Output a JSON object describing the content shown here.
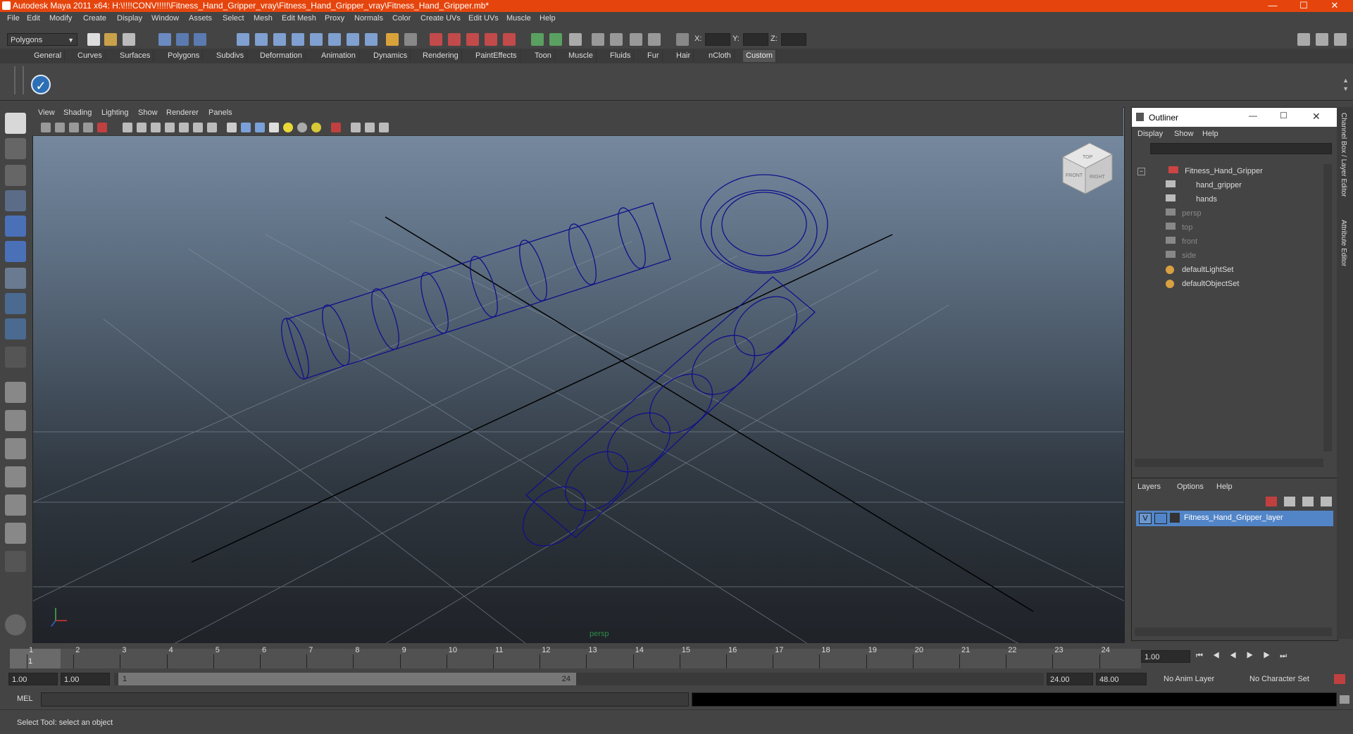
{
  "window": {
    "title": "Autodesk Maya 2011 x64: H:\\!!!!CONV!!!!!\\Fitness_Hand_Gripper_vray\\Fitness_Hand_Gripper_vray\\Fitness_Hand_Gripper.mb*"
  },
  "menu": [
    "File",
    "Edit",
    "Modify",
    "Create",
    "Display",
    "Window",
    "Assets",
    "Select",
    "Mesh",
    "Edit Mesh",
    "Proxy",
    "Normals",
    "Color",
    "Create UVs",
    "Edit UVs",
    "Muscle",
    "Help"
  ],
  "toolbar": {
    "mode": "Polygons",
    "x_label": "X:",
    "y_label": "Y:",
    "z_label": "Z:"
  },
  "shelf_tabs": [
    "General",
    "Curves",
    "Surfaces",
    "Polygons",
    "Subdivs",
    "Deformation",
    "Animation",
    "Dynamics",
    "Rendering",
    "PaintEffects",
    "Toon",
    "Muscle",
    "Fluids",
    "Fur",
    "Hair",
    "nCloth",
    "Custom"
  ],
  "viewport": {
    "menu": [
      "View",
      "Shading",
      "Lighting",
      "Show",
      "Renderer",
      "Panels"
    ],
    "camera_label": "persp",
    "cube_labels": {
      "top": "TOP",
      "front": "FRONT",
      "right": "RIGHT"
    },
    "wire_color": "#10108a"
  },
  "outliner": {
    "title": "Outliner",
    "menu": [
      "Display",
      "Show",
      "Help"
    ],
    "items": [
      {
        "label": "Fitness_Hand_Gripper",
        "dim": false
      },
      {
        "label": "hand_gripper",
        "dim": false
      },
      {
        "label": "hands",
        "dim": false
      },
      {
        "label": "persp",
        "dim": true
      },
      {
        "label": "top",
        "dim": true
      },
      {
        "label": "front",
        "dim": true
      },
      {
        "label": "side",
        "dim": true
      },
      {
        "label": "defaultLightSet",
        "dim": false
      },
      {
        "label": "defaultObjectSet",
        "dim": false
      }
    ]
  },
  "layers": {
    "menu": [
      "Layers",
      "Options",
      "Help"
    ],
    "layer": {
      "visible": "V",
      "name": "Fitness_Hand_Gripper_layer"
    }
  },
  "side_tabs": [
    "Channel Box / Layer Editor",
    "Attribute Editor"
  ],
  "timeline": {
    "ticks": [
      "1",
      "2",
      "3",
      "4",
      "5",
      "6",
      "7",
      "8",
      "9",
      "10",
      "11",
      "12",
      "13",
      "14",
      "15",
      "16",
      "17",
      "18",
      "19",
      "20",
      "21",
      "22",
      "23",
      "24"
    ],
    "current_frame": "1.00"
  },
  "range": {
    "start": "1.00",
    "start2": "1.00",
    "slider_start": "1",
    "slider_end": "24",
    "end": "24.00",
    "end2": "48.00",
    "anim_layer": "No Anim Layer",
    "char_set": "No Character Set"
  },
  "command": {
    "label": "MEL"
  },
  "help_line": "Select Tool: select an object"
}
